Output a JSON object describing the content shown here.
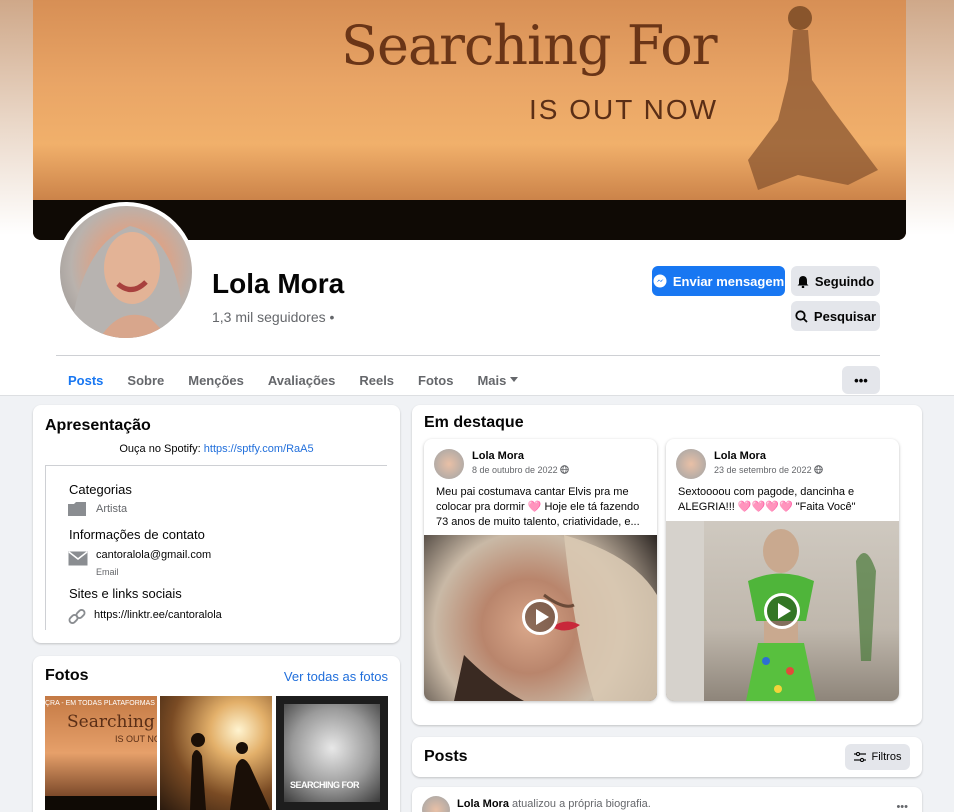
{
  "cover": {
    "title": "Searching For",
    "subtitle": "IS OUT NOW"
  },
  "profile": {
    "name": "Lola Mora",
    "followers": "1,3 mil seguidores •"
  },
  "actions": {
    "message": "Enviar mensagem",
    "following": "Seguindo",
    "search": "Pesquisar",
    "more": "•••"
  },
  "tabs": [
    "Posts",
    "Sobre",
    "Menções",
    "Avaliações",
    "Reels",
    "Fotos",
    "Mais"
  ],
  "intro": {
    "title": "Apresentação",
    "spotify_prefix": "Ouça no Spotify: ",
    "spotify_link": "https://sptfy.com/RaA5",
    "categories_heading": "Categorias",
    "category": "Artista",
    "contact_heading": "Informações de contato",
    "email": "cantoralola@gmail.com",
    "email_label": "Email",
    "links_heading": "Sites e links sociais",
    "link": "https://linktr.ee/cantoralola"
  },
  "photos": {
    "title": "Fotos",
    "see_all": "Ver todas as fotos",
    "p1_top": "ÇRA - EM TODAS PLATAFORMAS",
    "p1_title": "Searching For",
    "p1_sub": "IS OUT NO",
    "p3_title": "SEARCHING FOR"
  },
  "featured": {
    "title": "Em destaque",
    "items": [
      {
        "author": "Lola Mora",
        "date": "8 de outubro de 2022",
        "text": "Meu pai costumava cantar Elvis pra me colocar pra dormir 🩷 Hoje ele tá fazendo 73 anos de muito talento, criatividade, e..."
      },
      {
        "author": "Lola Mora",
        "date": "23 de setembro de 2022",
        "text": "Sextoooou com pagode, dancinha e ALEGRIA!!! 🩷🩷🩷🩷 \"Faita Você\""
      }
    ]
  },
  "posts": {
    "title": "Posts",
    "filter": "Filtros",
    "first_author": "Lola Mora",
    "first_action": " atualizou a própria biografia.",
    "more": "•••"
  },
  "colors": {
    "primary": "#1877f2",
    "link": "#216fdb",
    "bg": "#f0f2f5"
  }
}
